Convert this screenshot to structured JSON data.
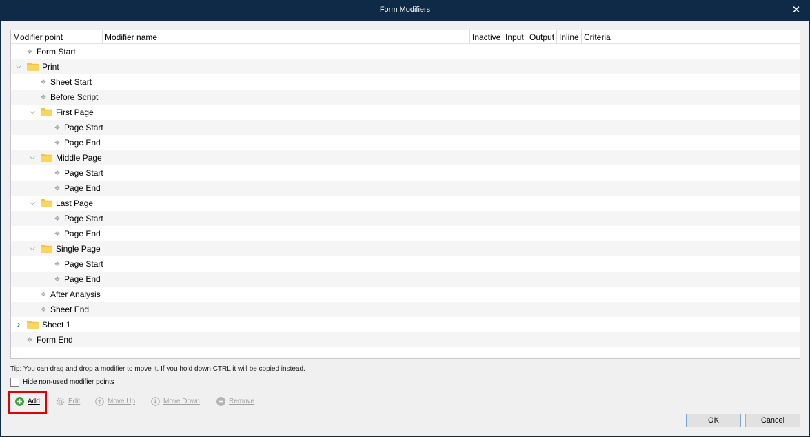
{
  "window": {
    "title": "Form Modifiers",
    "close_label": "✕"
  },
  "grid": {
    "columns": [
      "Modifier point",
      "Modifier name",
      "Inactive",
      "Input",
      "Output",
      "Inline",
      "Criteria"
    ],
    "rows": [
      {
        "label": "Form Start",
        "type": "leaf",
        "depth": 1
      },
      {
        "label": "Print",
        "type": "folder",
        "depth": 0,
        "expanded": true
      },
      {
        "label": "Sheet Start",
        "type": "leaf",
        "depth": 2
      },
      {
        "label": "Before Script",
        "type": "leaf",
        "depth": 2
      },
      {
        "label": "First Page",
        "type": "folder",
        "depth": 1,
        "expanded": true
      },
      {
        "label": "Page Start",
        "type": "leaf",
        "depth": 3
      },
      {
        "label": "Page End",
        "type": "leaf",
        "depth": 3
      },
      {
        "label": "Middle Page",
        "type": "folder",
        "depth": 1,
        "expanded": true
      },
      {
        "label": "Page Start",
        "type": "leaf",
        "depth": 3
      },
      {
        "label": "Page End",
        "type": "leaf",
        "depth": 3
      },
      {
        "label": "Last Page",
        "type": "folder",
        "depth": 1,
        "expanded": true
      },
      {
        "label": "Page Start",
        "type": "leaf",
        "depth": 3
      },
      {
        "label": "Page End",
        "type": "leaf",
        "depth": 3
      },
      {
        "label": "Single Page",
        "type": "folder",
        "depth": 1,
        "expanded": true
      },
      {
        "label": "Page Start",
        "type": "leaf",
        "depth": 3
      },
      {
        "label": "Page End",
        "type": "leaf",
        "depth": 3
      },
      {
        "label": "After Analysis",
        "type": "leaf",
        "depth": 2
      },
      {
        "label": "Sheet End",
        "type": "leaf",
        "depth": 2
      },
      {
        "label": "Sheet 1",
        "type": "folder",
        "depth": 0,
        "expanded": false
      },
      {
        "label": "Form End",
        "type": "leaf",
        "depth": 1
      }
    ]
  },
  "tip": "Tip: You can drag and drop a modifier to move it. If you hold down CTRL it will be copied instead.",
  "hide_checkbox": {
    "label": "Hide non-used modifier points",
    "checked": false
  },
  "toolbar": {
    "add": "Add",
    "edit": "Edit",
    "move_up": "Move Up",
    "move_down": "Move Down",
    "remove": "Remove"
  },
  "buttons": {
    "ok": "OK",
    "cancel": "Cancel"
  },
  "colors": {
    "titlebar": "#0e2a47",
    "add_icon": "#3aa33a",
    "folder": "#f5c342",
    "highlight": "#e00000",
    "chevron": "#3a6ea5"
  }
}
